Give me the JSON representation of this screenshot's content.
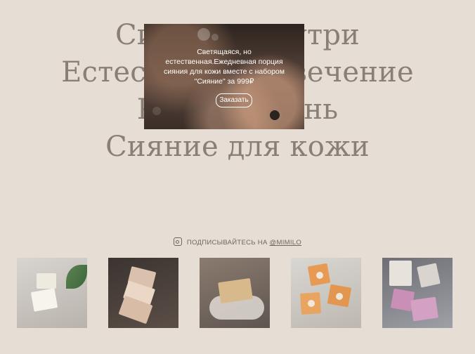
{
  "background_title": {
    "lines": [
      "Сияние изнутри",
      "Естественное свечение",
      "Каждый день",
      "Сияние для кожи"
    ]
  },
  "promo_modal": {
    "text": "Светящаяся, но естественная.Ежедневная порция сияния для кожи вместе с набором \"Сияние\" за 999₽",
    "button_label": "Заказать"
  },
  "instagram": {
    "icon": "instagram-icon",
    "prefix": "ПОДПИСЫВАЙТЕСЬ НА",
    "handle": "@MIMILO"
  },
  "gallery": {
    "items": [
      {
        "alt": "soap-photo-1"
      },
      {
        "alt": "soap-photo-2"
      },
      {
        "alt": "soap-photo-3"
      },
      {
        "alt": "soap-photo-4"
      },
      {
        "alt": "soap-photo-5"
      }
    ]
  },
  "colors": {
    "background": "#e6ddd5",
    "title_text": "#8a7f77",
    "muted_text": "#6f6660",
    "modal_text": "#ffffff"
  }
}
